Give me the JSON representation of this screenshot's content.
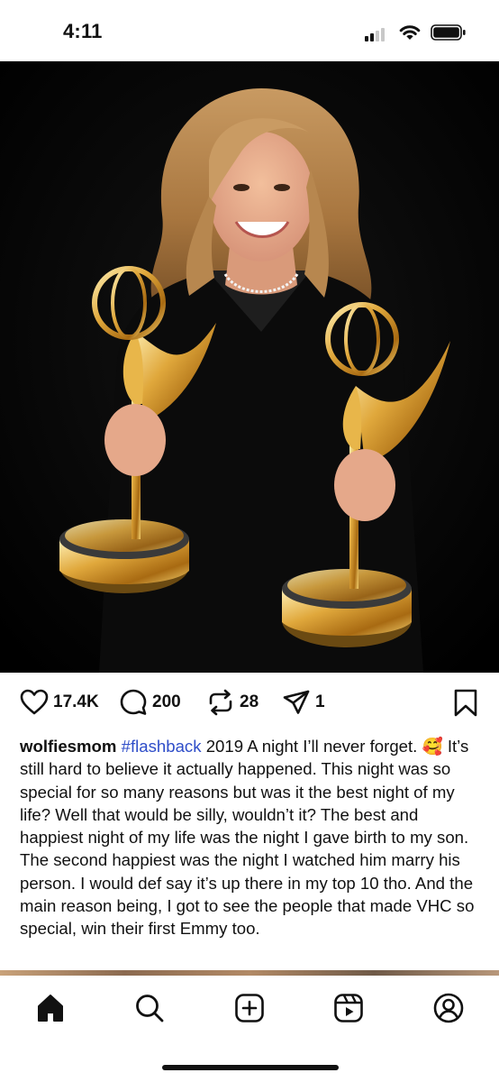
{
  "status_bar": {
    "time": "4:11",
    "icons": [
      "cellular-signal-icon",
      "wifi-icon",
      "battery-icon"
    ]
  },
  "post": {
    "image": {
      "alt_subject": "photo",
      "background_color": "#000000"
    },
    "actions": {
      "likes": "17.4K",
      "comments": "200",
      "reposts": "28",
      "shares": "1",
      "icons": [
        "heart-icon",
        "comment-icon",
        "repost-icon",
        "share-icon",
        "bookmark-icon"
      ]
    },
    "caption": {
      "username": "wolfiesmom",
      "hashtag": "#flashback",
      "text_1": " 2019 A night I’ll never forget. ",
      "emoji": "🥰",
      "text_2": " It’s still hard to believe it actually happened. This night was so special for so many reasons but was it the best night of my life? Well that would be silly, wouldn’t it? The best and happiest night of my life was the night I gave birth to my son. The second happiest was the night I watched him marry his person. I would def say it’s up there in my top 10 tho. And the main reason being, I got to see the people that made VHC so special, win their first Emmy too."
    }
  },
  "bottom_nav": {
    "items": [
      "home-icon",
      "search-icon",
      "create-icon",
      "reels-icon",
      "profile-icon"
    ],
    "active": "home-icon"
  },
  "colors": {
    "hashtag": "#2f4ec9",
    "text": "#111111",
    "gold": "#d9a23a"
  }
}
